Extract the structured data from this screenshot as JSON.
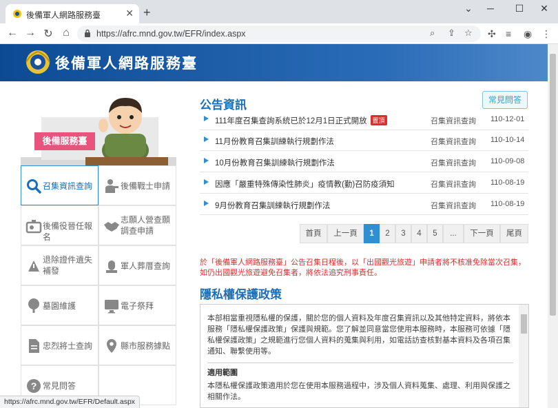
{
  "browser": {
    "tab_title": "後備軍人網路服務臺",
    "close_glyph": "✕",
    "newtab_glyph": "+",
    "url": "https://afrc.mnd.gov.tw/EFR/index.aspx",
    "status_url": "https://afrc.mnd.gov.tw/EFR/Default.aspx",
    "window": {
      "minimize": "─",
      "maximize": "☐",
      "close": "✕",
      "chevron": "⌄"
    }
  },
  "header": {
    "site_title": "後備軍人網路服務臺"
  },
  "sidebar": {
    "mascot_label": "後備服務臺",
    "menu": [
      {
        "label": "召集資訊查詢",
        "icon": "search-icon"
      },
      {
        "label": "後備戰士申請",
        "icon": "soldier-icon"
      },
      {
        "label": "後備役晉任報名",
        "icon": "badge-icon"
      },
      {
        "label": "志願人營查願調查申請",
        "icon": "handshake-icon"
      },
      {
        "label": "退除證件遺失補發",
        "icon": "document-icon"
      },
      {
        "label": "軍人葬厝查詢",
        "icon": "memorial-icon"
      },
      {
        "label": "墓園維護",
        "icon": "tree-icon"
      },
      {
        "label": "電子祭拜",
        "icon": "screen-icon"
      },
      {
        "label": "忠烈將士查詢",
        "icon": "file-icon"
      },
      {
        "label": "縣市服務據點",
        "icon": "location-icon"
      },
      {
        "label": "常見問答",
        "icon": "question-icon"
      }
    ]
  },
  "news": {
    "heading": "公告資訊",
    "faq_button": "常見問答",
    "items": [
      {
        "title": "111年度召集查詢系統已於12月1日正式開放",
        "badge": "置頂",
        "category": "召集資訊查詢",
        "date": "110-12-01"
      },
      {
        "title": "11月份教育召集訓練執行規劃作法",
        "badge": "",
        "category": "召集資訊查詢",
        "date": "110-10-14"
      },
      {
        "title": "10月份教育召集訓練執行規劃作法",
        "badge": "",
        "category": "召集資訊查詢",
        "date": "110-09-08"
      },
      {
        "title": "因應「嚴重特殊傳染性肺炎」疫情教(勤)召防疫須知",
        "badge": "",
        "category": "召集資訊查詢",
        "date": "110-08-19"
      },
      {
        "title": "9月份教育召集訓練執行規劃作法",
        "badge": "",
        "category": "召集資訊查詢",
        "date": "110-08-19"
      }
    ]
  },
  "pager": {
    "first": "首頁",
    "prev": "上一頁",
    "pages": [
      "1",
      "2",
      "3",
      "4",
      "5"
    ],
    "current": "1",
    "ellipsis": "...",
    "next": "下一頁",
    "last": "尾頁"
  },
  "notice": "於「後備軍人網路服務臺」公告召集日程後，以「出國觀光旅遊」申請者將不核准免除當次召集，如仍出國觀光旅遊避免召集者，將依法追究刑事責任。",
  "privacy": {
    "heading": "隱私權保護政策",
    "intro": "本部相當重視隱私權的保護，關於您的個人資料及年度召集資訊以及其他特定資料，將依本服務「隱私權保護政策」保護與規範。您了解並同意當您使用本服務時，本服務可依據「隱私權保護政策」之規範進行您個人資料的蒐集與利用，如電話訪查核對基本資料及各項召集通知、聯繫使用等。",
    "section_title": "適用範圍",
    "section_text": "本隱私權保護政策適用於您在使用本服務過程中，涉及個人資料蒐集、處理、利用與保護之相關作法。"
  },
  "colors": {
    "accent": "#1a6fb8",
    "banner": "#0c4b94",
    "alert": "#d9302c",
    "pager_active": "#2f8fd1"
  }
}
